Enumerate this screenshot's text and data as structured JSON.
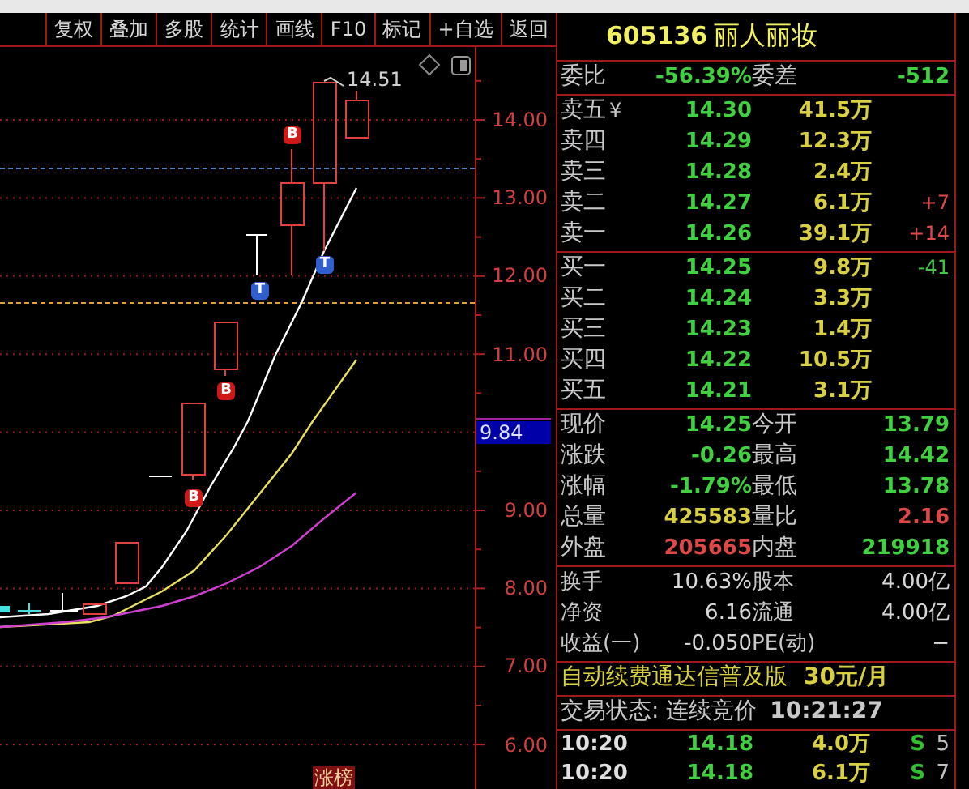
{
  "toolbar": {
    "buttons": [
      "复权",
      "叠加",
      "多股",
      "统计",
      "画线",
      "F10",
      "标记",
      "+自选",
      "返回"
    ]
  },
  "chart": {
    "y_axis_labels": [
      "14.00",
      "13.00",
      "12.00",
      "11.00",
      "9.00",
      "8.00",
      "7.00",
      "6.00"
    ],
    "high_label": "14.51",
    "current_price_tag": "9.84",
    "bottom_tag": "涨榜",
    "markers": [
      {
        "kind": "buy",
        "label": "B"
      },
      {
        "kind": "buy",
        "label": "B"
      },
      {
        "kind": "buy",
        "label": "B"
      },
      {
        "kind": "t",
        "label": "T"
      },
      {
        "kind": "t",
        "label": "T"
      }
    ]
  },
  "quote": {
    "code": "605136",
    "name": "丽人丽妆",
    "ratio": {
      "label": "委比",
      "value": "-56.39%",
      "diff_label": "委差",
      "diff_value": "-512"
    },
    "asks": [
      {
        "label": "卖五",
        "icon": "¥",
        "price": "14.30",
        "volume": "41.5万"
      },
      {
        "label": "卖四",
        "price": "14.29",
        "volume": "12.3万"
      },
      {
        "label": "卖三",
        "price": "14.28",
        "volume": "2.4万"
      },
      {
        "label": "卖二",
        "price": "14.27",
        "volume": "6.1万",
        "change": "+7",
        "color": "#e04848"
      },
      {
        "label": "卖一",
        "price": "14.26",
        "volume": "39.1万",
        "change": "+14",
        "color": "#e04848"
      }
    ],
    "bids": [
      {
        "label": "买一",
        "price": "14.25",
        "volume": "9.8万",
        "change": "-41",
        "color": "#40c840"
      },
      {
        "label": "买二",
        "price": "14.24",
        "volume": "3.3万"
      },
      {
        "label": "买三",
        "price": "14.23",
        "volume": "1.4万"
      },
      {
        "label": "买四",
        "price": "14.22",
        "volume": "10.5万"
      },
      {
        "label": "买五",
        "price": "14.21",
        "volume": "3.1万"
      }
    ],
    "stats": [
      {
        "label": "现价",
        "value": "14.25",
        "color": "#40d040"
      },
      {
        "label": "今开",
        "value": "13.79",
        "color": "#40d040"
      },
      {
        "label": "涨跌",
        "value": "-0.26",
        "color": "#40d040"
      },
      {
        "label": "最高",
        "value": "14.42",
        "color": "#40d040"
      },
      {
        "label": "涨幅",
        "value": "-1.79%",
        "color": "#40d040"
      },
      {
        "label": "最低",
        "value": "13.78",
        "color": "#40d040"
      },
      {
        "label": "总量",
        "value": "425583",
        "color": "#d8d040"
      },
      {
        "label": "量比",
        "value": "2.16",
        "color": "#e04848"
      },
      {
        "label": "外盘",
        "value": "205665",
        "color": "#e04848"
      },
      {
        "label": "内盘",
        "value": "219918",
        "color": "#40d040"
      }
    ],
    "fundamentals": [
      {
        "label": "换手",
        "value": "10.63%"
      },
      {
        "label": "股本",
        "value": "4.00亿"
      },
      {
        "label": "净资",
        "value": "6.16"
      },
      {
        "label": "流通",
        "value": "4.00亿"
      },
      {
        "label": "收益(一)",
        "value": "-0.050"
      },
      {
        "label": "PE(动)",
        "value": "−"
      }
    ],
    "ad": {
      "text": "自动续费通达信普及版",
      "price": "30元/月"
    },
    "status": {
      "text": "交易状态: 连续竞价",
      "time": "10:21:27"
    },
    "ticks": [
      {
        "time": "10:20",
        "price": "14.18",
        "volume": "4.0万",
        "side": "S",
        "color": "#30c030",
        "count": "5"
      },
      {
        "time": "10:20",
        "price": "14.18",
        "volume": "6.1万",
        "side": "S",
        "color": "#30c030",
        "count": "7"
      }
    ]
  }
}
